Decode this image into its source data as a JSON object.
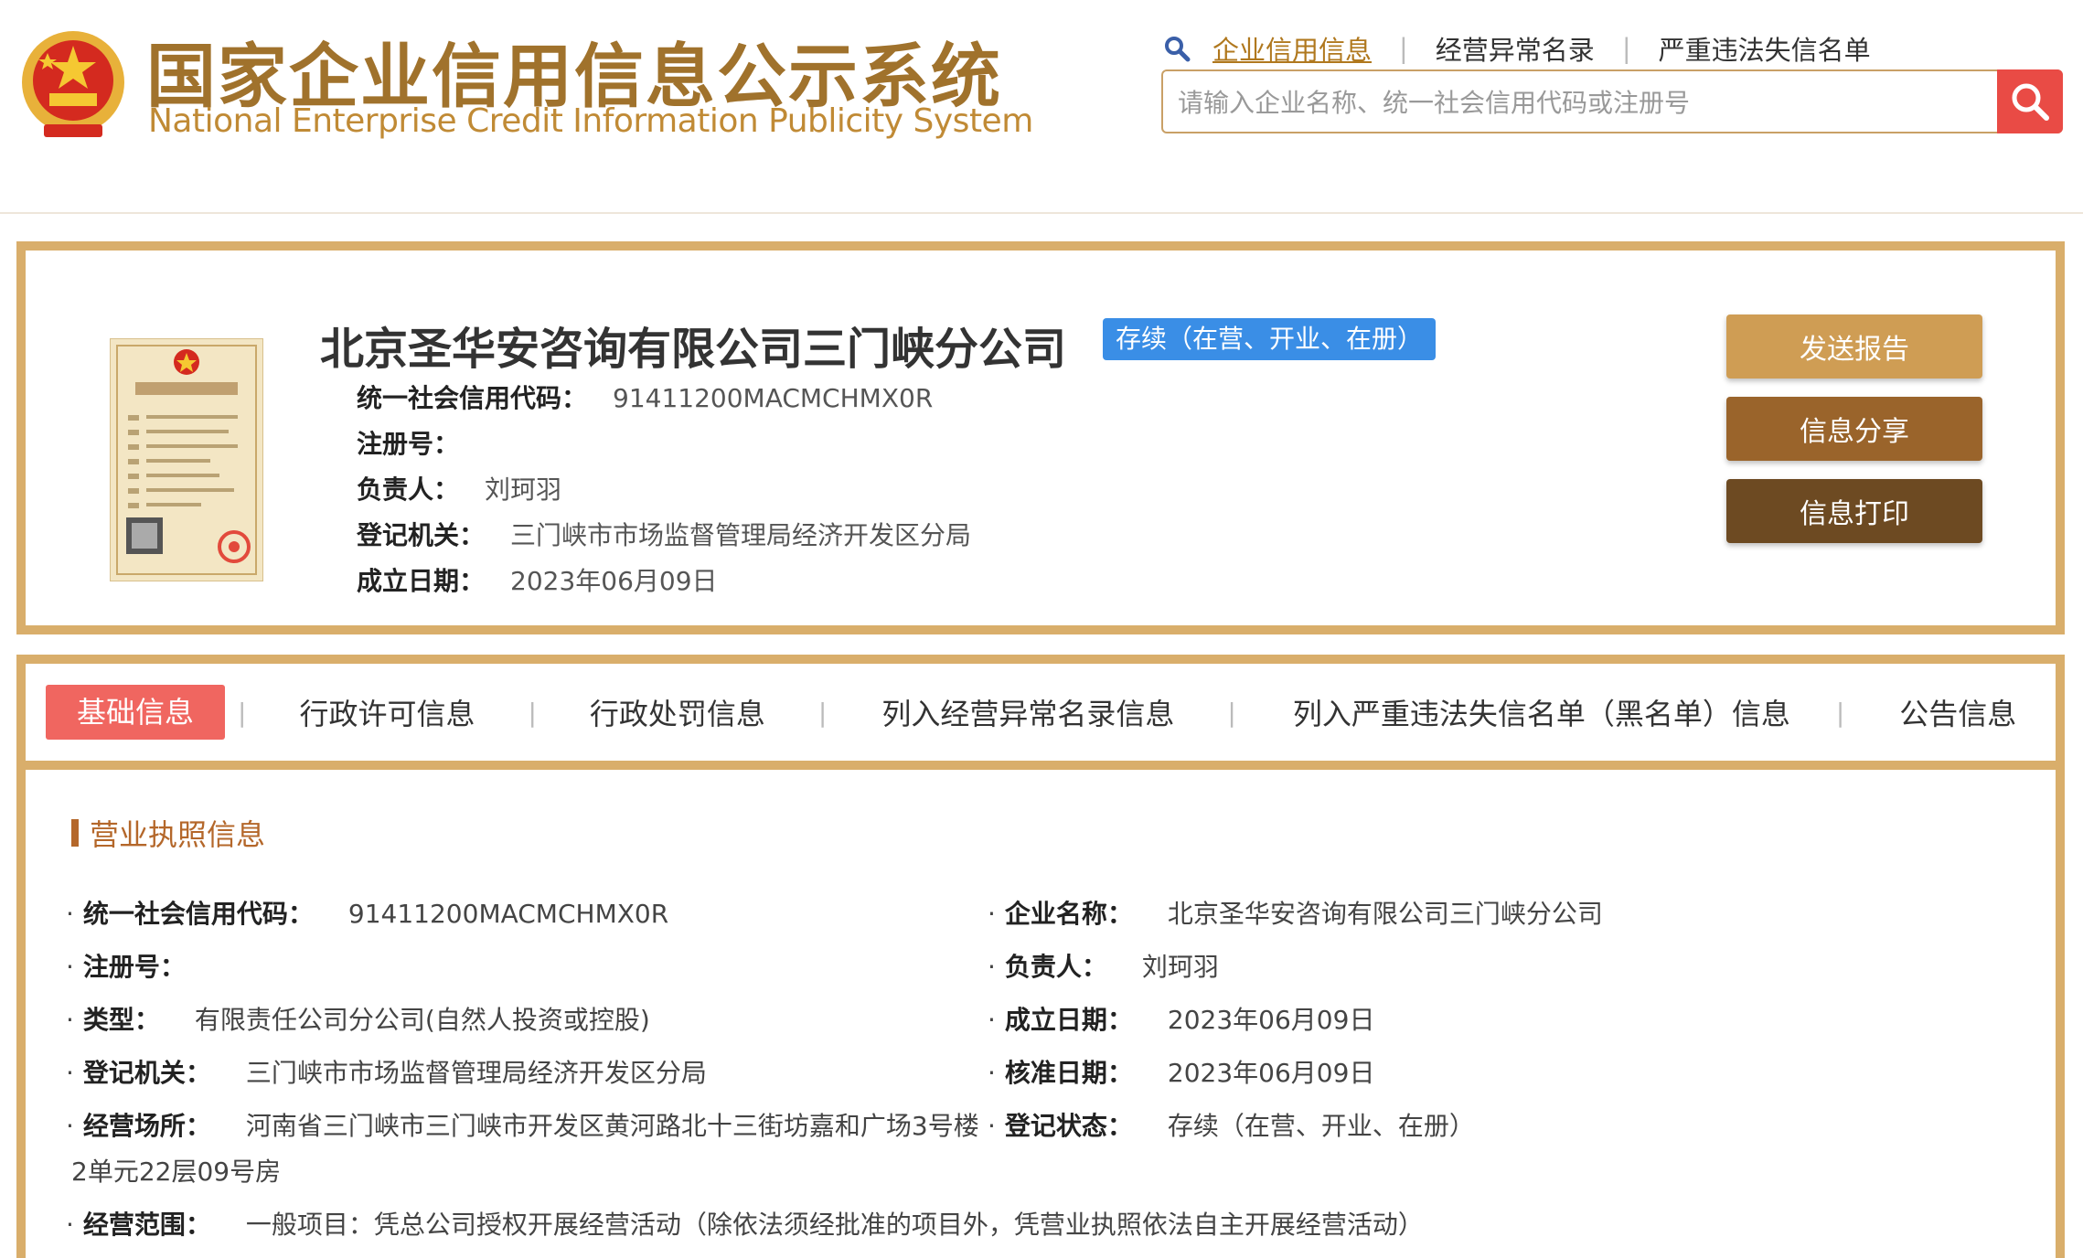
{
  "header": {
    "title_cn": "国家企业信用信息公示系统",
    "title_en": "National Enterprise Credit Information Publicity System",
    "nav": [
      {
        "label": "企业信用信息",
        "active": true
      },
      {
        "label": "经营异常名录",
        "active": false
      },
      {
        "label": "严重违法失信名单",
        "active": false
      }
    ],
    "search": {
      "placeholder": "请输入企业名称、统一社会信用代码或注册号",
      "value": ""
    }
  },
  "company": {
    "name": "北京圣华安咨询有限公司三门峡分公司",
    "status": "存续（在营、开业、在册）",
    "credit_code_label": "统一社会信用代码：",
    "credit_code": "91411200MACMCHMX0R",
    "reg_no_label": "注册号：",
    "reg_no": "",
    "person_label": "负责人：",
    "person": "刘珂羽",
    "authority_label": "登记机关：",
    "authority": "三门峡市市场监督管理局经济开发区分局",
    "date_label": "成立日期：",
    "date": "2023年06月09日"
  },
  "actions": {
    "send_report": "发送报告",
    "share": "信息分享",
    "print": "信息打印"
  },
  "tabs": [
    {
      "label": "基础信息",
      "active": true
    },
    {
      "label": "行政许可信息",
      "active": false
    },
    {
      "label": "行政处罚信息",
      "active": false
    },
    {
      "label": "列入经营异常名录信息",
      "active": false
    },
    {
      "label": "列入严重违法失信名单（黑名单）信息",
      "active": false
    },
    {
      "label": "公告信息",
      "active": false
    }
  ],
  "license": {
    "section_title": "营业执照信息",
    "fields": {
      "credit_code": {
        "label": "统一社会信用代码：",
        "value": "91411200MACMCHMX0R"
      },
      "ent_name": {
        "label": "企业名称：",
        "value": "北京圣华安咨询有限公司三门峡分公司"
      },
      "reg_no": {
        "label": "注册号：",
        "value": ""
      },
      "person": {
        "label": "负责人：",
        "value": "刘珂羽"
      },
      "type": {
        "label": "类型：",
        "value": "有限责任公司分公司(自然人投资或控股)"
      },
      "est_date": {
        "label": "成立日期：",
        "value": "2023年06月09日"
      },
      "authority": {
        "label": "登记机关：",
        "value": "三门峡市市场监督管理局经济开发区分局"
      },
      "approve_date": {
        "label": "核准日期：",
        "value": "2023年06月09日"
      },
      "address": {
        "label": "经营场所：",
        "value": "河南省三门峡市三门峡市开发区黄河路北十三街坊嘉和广场3号楼",
        "value_cont": "2单元22层09号房"
      },
      "reg_status": {
        "label": "登记状态：",
        "value": "存续（在营、开业、在册）"
      },
      "scope": {
        "label": "经营范围：",
        "value": "一般项目：凭总公司授权开展经营活动（除依法须经批准的项目外，凭营业执照依法自主开展经营活动）"
      }
    }
  },
  "colors": {
    "gold_border": "#d9ae6b",
    "btn_send": "#cf9d54",
    "btn_share": "#9a642b",
    "btn_print": "#6d4a22",
    "badge": "#3a8ee6",
    "tab_active": "#f06660",
    "search_btn": "#e94b45",
    "section_title": "#b4672a"
  }
}
